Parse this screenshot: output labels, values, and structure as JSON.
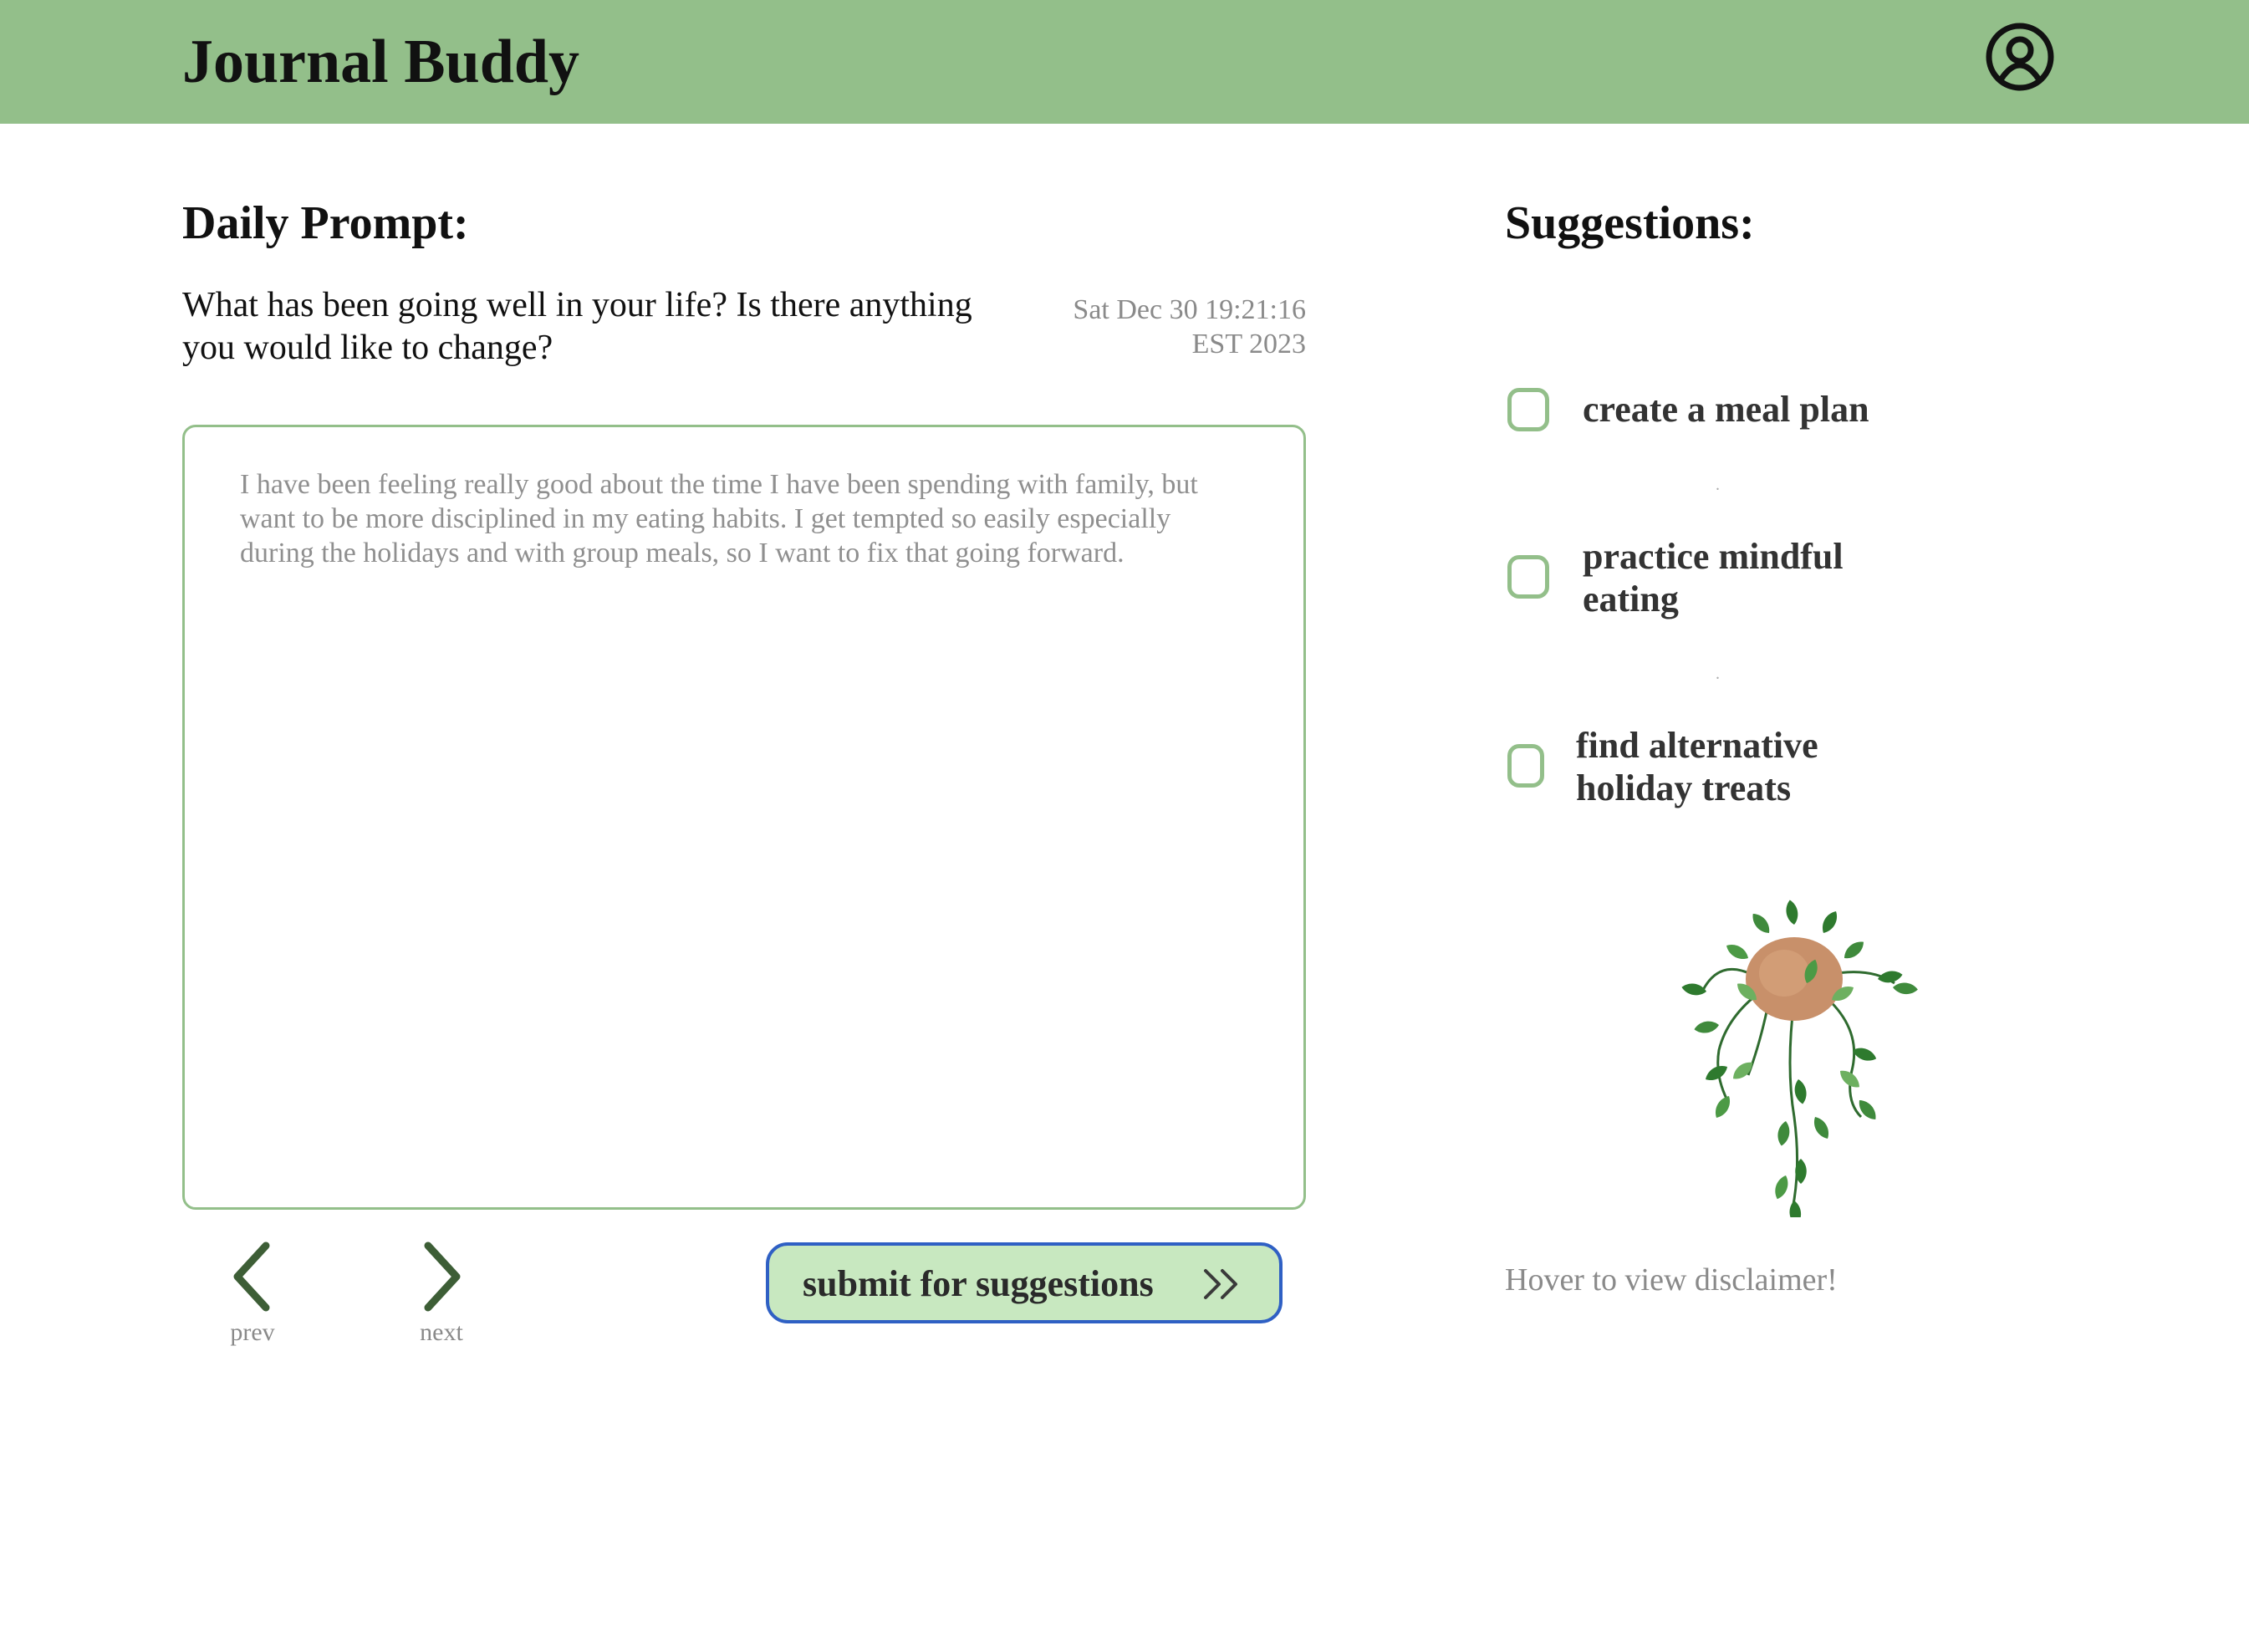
{
  "header": {
    "app_title": "Journal Buddy",
    "account_icon": "account-circle-icon"
  },
  "prompt": {
    "heading": "Daily Prompt:",
    "question": "What has been going well in your life? Is there anything you would like to change?",
    "timestamp_line1": "Sat Dec 30 19:21:16",
    "timestamp_line2": "EST 2023"
  },
  "journal": {
    "entry_text": "I have been feeling really good about the time I have been spending with family, but want to be more disciplined in my eating habits. I get tempted so easily especially during the holidays and with group meals, so I want to fix that going forward."
  },
  "navigation": {
    "prev_label": "prev",
    "next_label": "next",
    "prev_icon": "chevron-left-icon",
    "next_icon": "chevron-right-icon"
  },
  "submit": {
    "label": "submit for suggestions",
    "icon": "double-chevron-right-icon"
  },
  "suggestions": {
    "heading": "Suggestions:",
    "items": [
      {
        "label": "create a meal plan",
        "checked": false
      },
      {
        "label": "practice mindful eating",
        "checked": false
      },
      {
        "label": "find alternative holiday treats",
        "checked": false
      }
    ],
    "separator": "."
  },
  "plant_icon": "hanging-plant-illustration",
  "disclaimer": "Hover to view disclaimer!",
  "colors": {
    "header_bg": "#93bf8a",
    "accent_green": "#93bf8a",
    "button_bg": "#c8e8c0",
    "button_border": "#2f60c4",
    "nav_chevron": "#3d5e36"
  }
}
